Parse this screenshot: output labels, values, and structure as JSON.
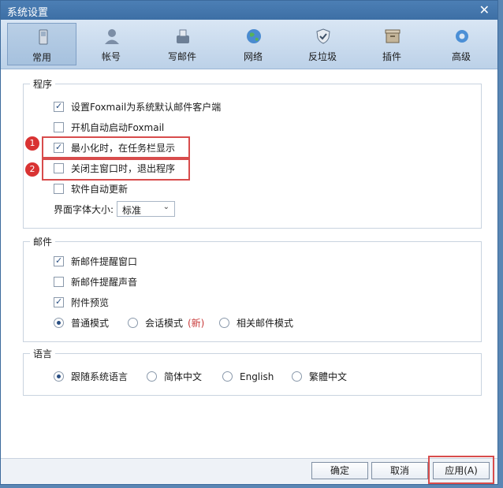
{
  "window": {
    "title": "系统设置"
  },
  "toolbar": {
    "items": [
      {
        "label": "常用",
        "icon": "phone-icon"
      },
      {
        "label": "帐号",
        "icon": "user-icon"
      },
      {
        "label": "写邮件",
        "icon": "compose-icon"
      },
      {
        "label": "网络",
        "icon": "globe-icon"
      },
      {
        "label": "反垃圾",
        "icon": "shield-icon"
      },
      {
        "label": "插件",
        "icon": "box-icon"
      },
      {
        "label": "高级",
        "icon": "gear-icon"
      }
    ]
  },
  "program": {
    "title": "程序",
    "items": [
      {
        "label": "设置Foxmail为系统默认邮件客户端",
        "checked": true
      },
      {
        "label": "开机自动启动Foxmail",
        "checked": false
      },
      {
        "label": "最小化时，在任务栏显示",
        "checked": true
      },
      {
        "label": "关闭主窗口时，退出程序",
        "checked": false
      },
      {
        "label": "软件自动更新",
        "checked": false
      }
    ],
    "font_size_label": "界面字体大小:",
    "font_size_value": "标准"
  },
  "mail": {
    "title": "邮件",
    "items": [
      {
        "label": "新邮件提醒窗口",
        "checked": true
      },
      {
        "label": "新邮件提醒声音",
        "checked": false
      },
      {
        "label": "附件预览",
        "checked": true
      }
    ],
    "modes": {
      "normal": "普通模式",
      "conversation": "会话模式",
      "new_tag": "(新)",
      "related": "相关邮件模式"
    }
  },
  "language": {
    "title": "语言",
    "options": [
      "跟随系统语言",
      "简体中文",
      "English",
      "繁體中文"
    ]
  },
  "annotations": {
    "badge1": "1",
    "badge2": "2"
  },
  "footer": {
    "ok": "确定",
    "cancel": "取消",
    "apply": "应用(A)"
  }
}
